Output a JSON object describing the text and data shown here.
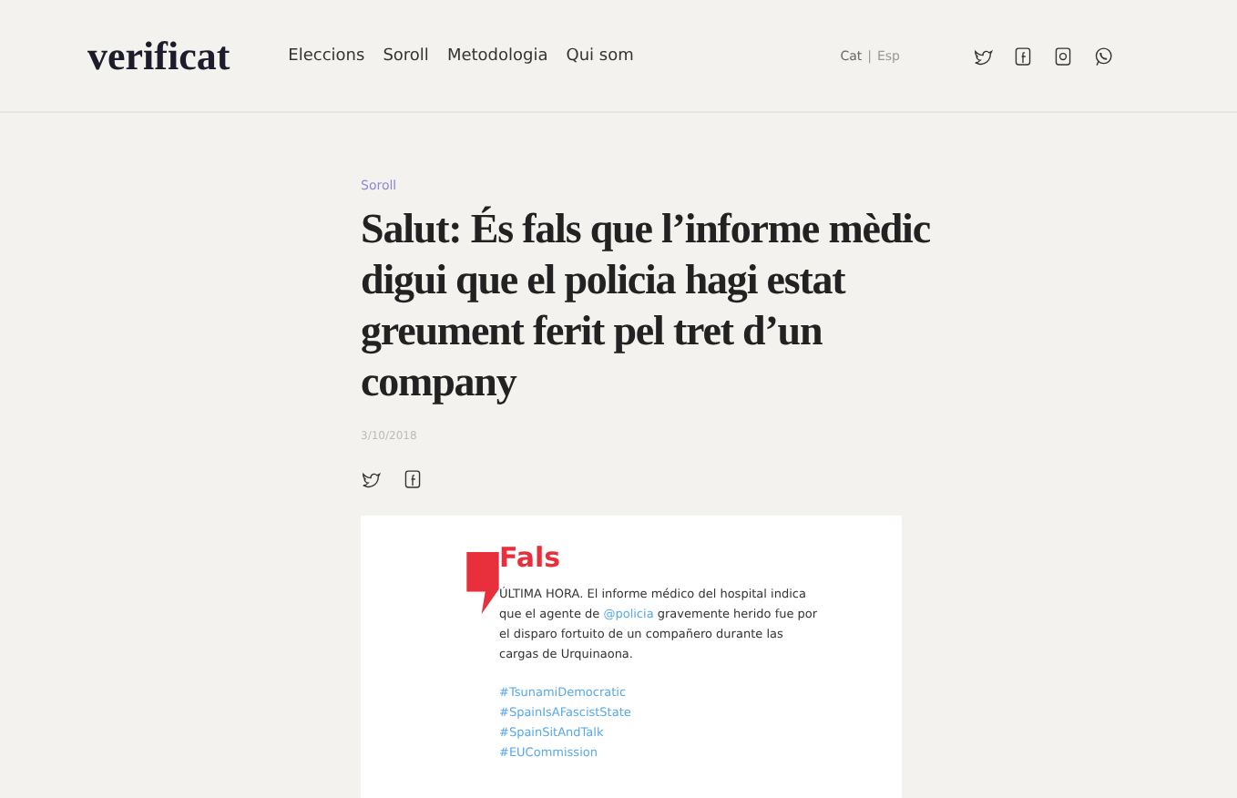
{
  "header": {
    "logo": "verificat",
    "nav": [
      "Eleccions",
      "Soroll",
      "Metodologia",
      "Qui som"
    ],
    "language_separator": "|",
    "languages": [
      {
        "label": "Cat",
        "selected": true
      },
      {
        "label": "Esp",
        "selected": false
      }
    ]
  },
  "article": {
    "category": "Soroll",
    "title": "Salut: És fals que l’informe mèdic digui que el policia hagi estat greument ferit pel tret d’un company",
    "date": "3/10/2018",
    "verdict": "Fals",
    "tweet_start": "ÚLTIMA HORA. El informe médico del hospital indica que el agente de",
    "mention": "@policia",
    "tweet_end": "gravemente herido fue por el disparo fortuito de un compañero durante las cargas de Urquinaona.",
    "hashtags": [
      "#TsunamiDemocratic",
      "#SpainIsAFascistState",
      "#SpainSitAndTalk",
      "#EUCommission"
    ]
  }
}
